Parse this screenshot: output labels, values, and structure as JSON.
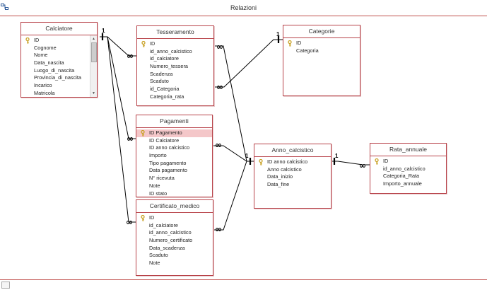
{
  "window": {
    "title": "Relazioni",
    "icon": "relationships-icon"
  },
  "tables": {
    "calciatore": {
      "name": "Calciatore",
      "fields": [
        "ID",
        "Cognome",
        "Nome",
        "Data_nascita",
        "Luogo_di_nascita",
        "Provincia_di_nascita",
        "Incarico",
        "Matricola"
      ],
      "key_fields": [
        "ID"
      ]
    },
    "tesseramento": {
      "name": "Tesseramento",
      "fields": [
        "ID",
        "id_anno_calcistico",
        "id_calciatore",
        "Numero_tessera",
        "Scadenza",
        "Scaduto",
        "id_Categoria",
        "Categoria_rata"
      ],
      "key_fields": [
        "ID"
      ]
    },
    "categorie": {
      "name": "Categorie",
      "fields": [
        "ID",
        "Categoria"
      ],
      "key_fields": [
        "ID"
      ]
    },
    "pagamenti": {
      "name": "Pagamenti",
      "fields": [
        "ID Pagamento",
        "ID Calciatore",
        "ID anno calcistico",
        "Importo",
        "Tipo pagamento",
        "Data pagamento",
        "N° ricevuta",
        "Note",
        "ID stato"
      ],
      "key_fields": [
        "ID Pagamento"
      ],
      "selected_field": "ID Pagamento"
    },
    "anno_calcistico": {
      "name": "Anno_calcistico",
      "fields": [
        "ID anno calcistico",
        "Anno calcistico",
        "Data_inizio",
        "Data_fine"
      ],
      "key_fields": [
        "ID anno calcistico"
      ]
    },
    "rata_annuale": {
      "name": "Rata_annuale",
      "fields": [
        "ID",
        "id_anno_calcistico",
        "Categoria_Rata",
        "Importo_annuale"
      ],
      "key_fields": [
        "ID"
      ]
    },
    "certificato_medico": {
      "name": "Certificato_medico",
      "fields": [
        "ID",
        "id_calciatore",
        "id_anno_calcistico",
        "Numero_certificato",
        "Data_scadenza",
        "Scaduto",
        "Note"
      ],
      "key_fields": [
        "ID"
      ]
    }
  },
  "relationships": [
    {
      "from": "Calciatore",
      "to": "Tesseramento",
      "one": "1",
      "many": "∞"
    },
    {
      "from": "Calciatore",
      "to": "Pagamenti",
      "one": "1",
      "many": "∞"
    },
    {
      "from": "Calciatore",
      "to": "Certificato_medico",
      "one": "1",
      "many": "∞"
    },
    {
      "from": "Categorie",
      "to": "Tesseramento",
      "one": "1",
      "many": "∞"
    },
    {
      "from": "Anno_calcistico",
      "to": "Tesseramento",
      "one": "1",
      "many": "∞"
    },
    {
      "from": "Anno_calcistico",
      "to": "Pagamenti",
      "one": "1",
      "many": "∞"
    },
    {
      "from": "Anno_calcistico",
      "to": "Certificato_medico",
      "one": "1",
      "many": "∞"
    },
    {
      "from": "Anno_calcistico",
      "to": "Rata_annuale",
      "one": "1",
      "many": "∞"
    }
  ],
  "colors": {
    "border": "#b8434a",
    "selected_row": "#f4c7c9",
    "line": "#000000"
  }
}
